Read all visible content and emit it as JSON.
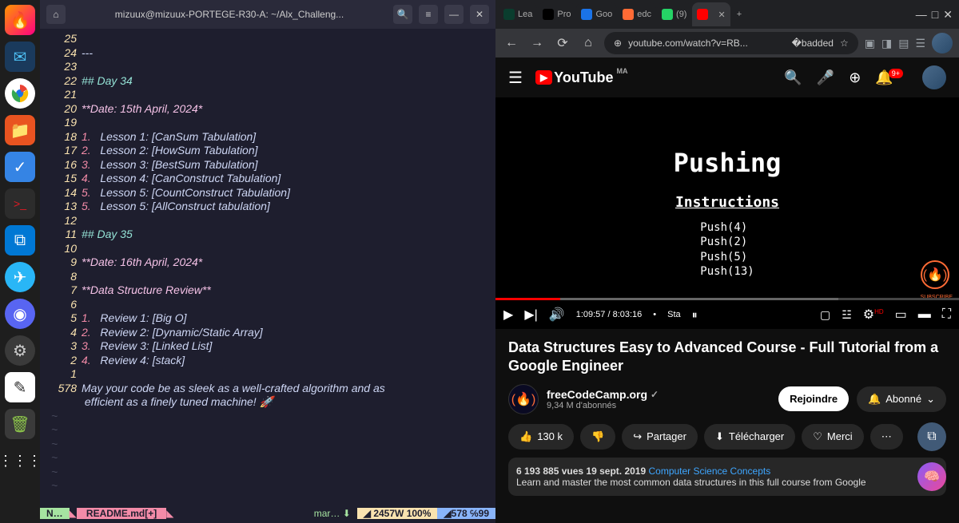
{
  "dock": {
    "items": [
      "firefox",
      "thunderbird",
      "chrome",
      "files",
      "todo",
      "terminal",
      "vscode",
      "telegram",
      "discord",
      "settings",
      "notes",
      "trash",
      "apps"
    ]
  },
  "terminal": {
    "title": "mizuux@mizuux-PORTEGE-R30-A: ~/Alx_Challeng...",
    "lines": [
      {
        "n": "25",
        "t": ""
      },
      {
        "n": "24",
        "t": "---"
      },
      {
        "n": "23",
        "t": ""
      },
      {
        "n": "22",
        "t": "## Day 34",
        "cls": "hdr"
      },
      {
        "n": "21",
        "t": ""
      },
      {
        "n": "20",
        "t": "**Date: 15th April, 2024*",
        "cls": "bold"
      },
      {
        "n": "19",
        "t": ""
      },
      {
        "n": "18",
        "t": "1.   Lesson 1: [CanSum Tabulation]",
        "num": "1."
      },
      {
        "n": "17",
        "t": "2.   Lesson 2: [HowSum Tabulation]",
        "num": "2."
      },
      {
        "n": "16",
        "t": "3.   Lesson 3: [BestSum Tabulation]",
        "num": "3."
      },
      {
        "n": "15",
        "t": "4.   Lesson 4: [CanConstruct Tabulation]",
        "num": "4."
      },
      {
        "n": "14",
        "t": "5.   Lesson 5: [CountConstruct Tabulation]",
        "num": "5."
      },
      {
        "n": "13",
        "t": "5.   Lesson 5: [AllConstruct tabulation]",
        "num": "5."
      },
      {
        "n": "12",
        "t": ""
      },
      {
        "n": "11",
        "t": "## Day 35",
        "cls": "hdr"
      },
      {
        "n": "10",
        "t": ""
      },
      {
        "n": "9",
        "t": "**Date: 16th April, 2024*",
        "cls": "bold"
      },
      {
        "n": "8",
        "t": ""
      },
      {
        "n": "7",
        "t": "**Data Structure Review**",
        "cls": "bold"
      },
      {
        "n": "6",
        "t": ""
      },
      {
        "n": "5",
        "t": "1.   Review 1: [Big O]",
        "num": "1."
      },
      {
        "n": "4",
        "t": "2.   Review 2: [Dynamic/Static Array]",
        "num": "2."
      },
      {
        "n": "3",
        "t": "3.   Review 3: [Linked List]",
        "num": "3."
      },
      {
        "n": "2",
        "t": "4.   Review 4: [stack]",
        "num": "4."
      },
      {
        "n": "1",
        "t": ""
      },
      {
        "n": "578",
        "t": "May your code be as sleek as a well-crafted algorithm and as"
      },
      {
        "n": "",
        "t": " efficient as a finely tuned machine! 🚀"
      }
    ],
    "status": {
      "mode": "N…",
      "file": "README.md[+]",
      "branch": "mar… ",
      "words": "2457W",
      "pct": "100%",
      "line": "578",
      "col": "99"
    }
  },
  "browser": {
    "tabs": [
      {
        "label": "Lea",
        "icon": "#0a3d2e"
      },
      {
        "label": "Pro",
        "icon": "#000"
      },
      {
        "label": "Goo",
        "icon": "#1a73e8"
      },
      {
        "label": "edc",
        "icon": "#ff6b35"
      },
      {
        "label": "(9)",
        "icon": "#25d366"
      },
      {
        "label": "",
        "icon": "#ff0000",
        "active": true
      }
    ],
    "url": "youtube.com/watch?v=RB..."
  },
  "youtube": {
    "region": "MA",
    "notifications": "9+",
    "video": {
      "title": "Pushing",
      "subtitle": "Instructions",
      "code": [
        "Push(4)",
        "Push(2)",
        "Push(5)",
        "Push(13)"
      ]
    },
    "player": {
      "time": "1:09:57 / 8:03:16",
      "stable": "Sta",
      "hd": "HD"
    },
    "title": "Data Structures Easy to Advanced Course - Full Tutorial from a Google Engineer",
    "channel": {
      "name": "freeCodeCamp.org",
      "subs": "9,34 M d'abonnés"
    },
    "join": "Rejoindre",
    "subscribed": "Abonné",
    "likes": "130 k",
    "share": "Partager",
    "download": "Télécharger",
    "thanks": "Merci",
    "desc": {
      "views": "6 193 885 vues",
      "date": "19 sept. 2019",
      "topic": "Computer Science Concepts",
      "text": "Learn and master the most common data structures in this full course from Google"
    }
  }
}
